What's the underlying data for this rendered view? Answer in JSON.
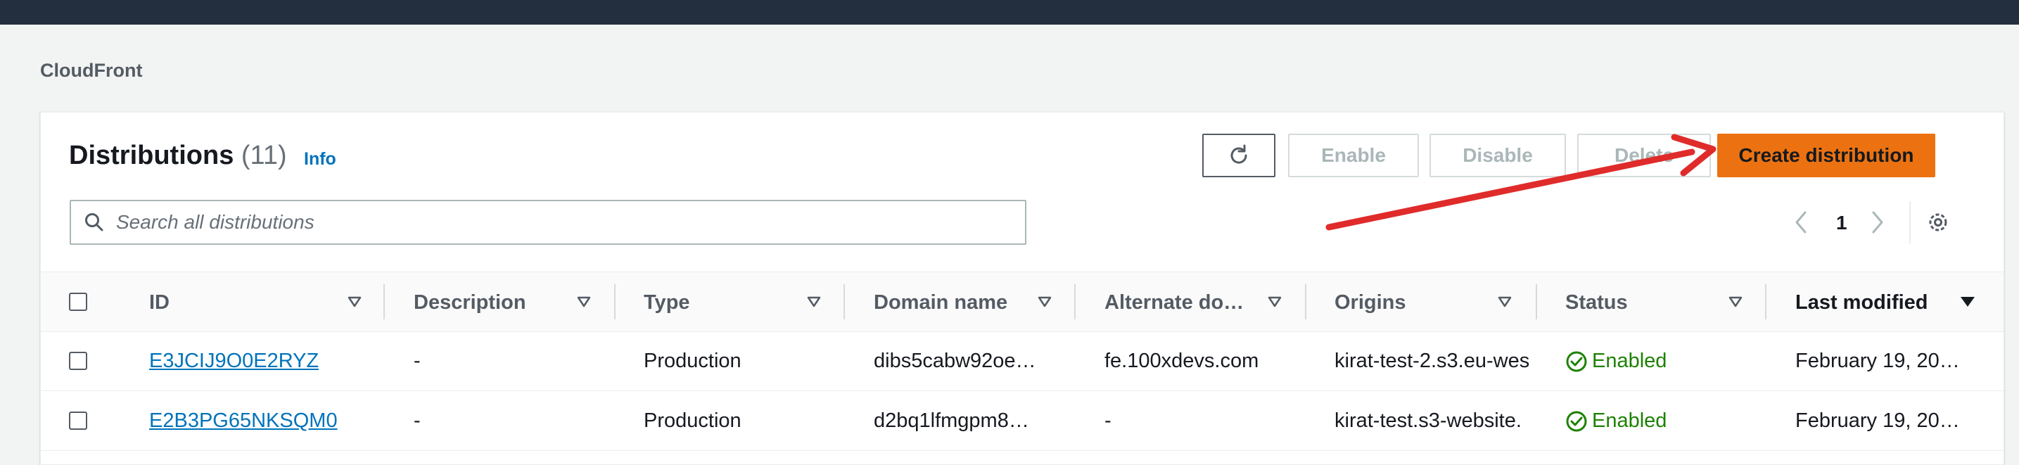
{
  "breadcrumb": "CloudFront",
  "header": {
    "title": "Distributions",
    "count": "(11)",
    "info": "Info"
  },
  "toolbar": {
    "refresh_icon": "refresh-icon",
    "enable_label": "Enable",
    "disable_label": "Disable",
    "delete_label": "Delete",
    "create_label": "Create distribution"
  },
  "search": {
    "placeholder": "Search all distributions",
    "value": ""
  },
  "pagination": {
    "current_page": "1"
  },
  "table": {
    "columns": [
      "ID",
      "Description",
      "Type",
      "Domain name",
      "Alternate do…",
      "Origins",
      "Status",
      "Last modified"
    ],
    "sorted_column": "Last modified",
    "rows": [
      {
        "id": "E3JCIJ9O0E2RYZ",
        "description": "-",
        "type": "Production",
        "domain": "dibs5cabw92oe…",
        "alternate": "fe.100xdevs.com",
        "origins": "kirat-test-2.s3.eu-wes",
        "status": "Enabled",
        "modified": "February 19, 20…"
      },
      {
        "id": "E2B3PG65NKSQM0",
        "description": "-",
        "type": "Production",
        "domain": "d2bq1lfmgpm8…",
        "alternate": "-",
        "origins": "kirat-test.s3-website.",
        "status": "Enabled",
        "modified": "February 19, 20…"
      }
    ]
  },
  "colors": {
    "topbar": "#232f3e",
    "primary_button": "#ec7211",
    "link": "#0073bb",
    "status_enabled": "#1d8102",
    "annotation_arrow": "#e02b2b"
  }
}
